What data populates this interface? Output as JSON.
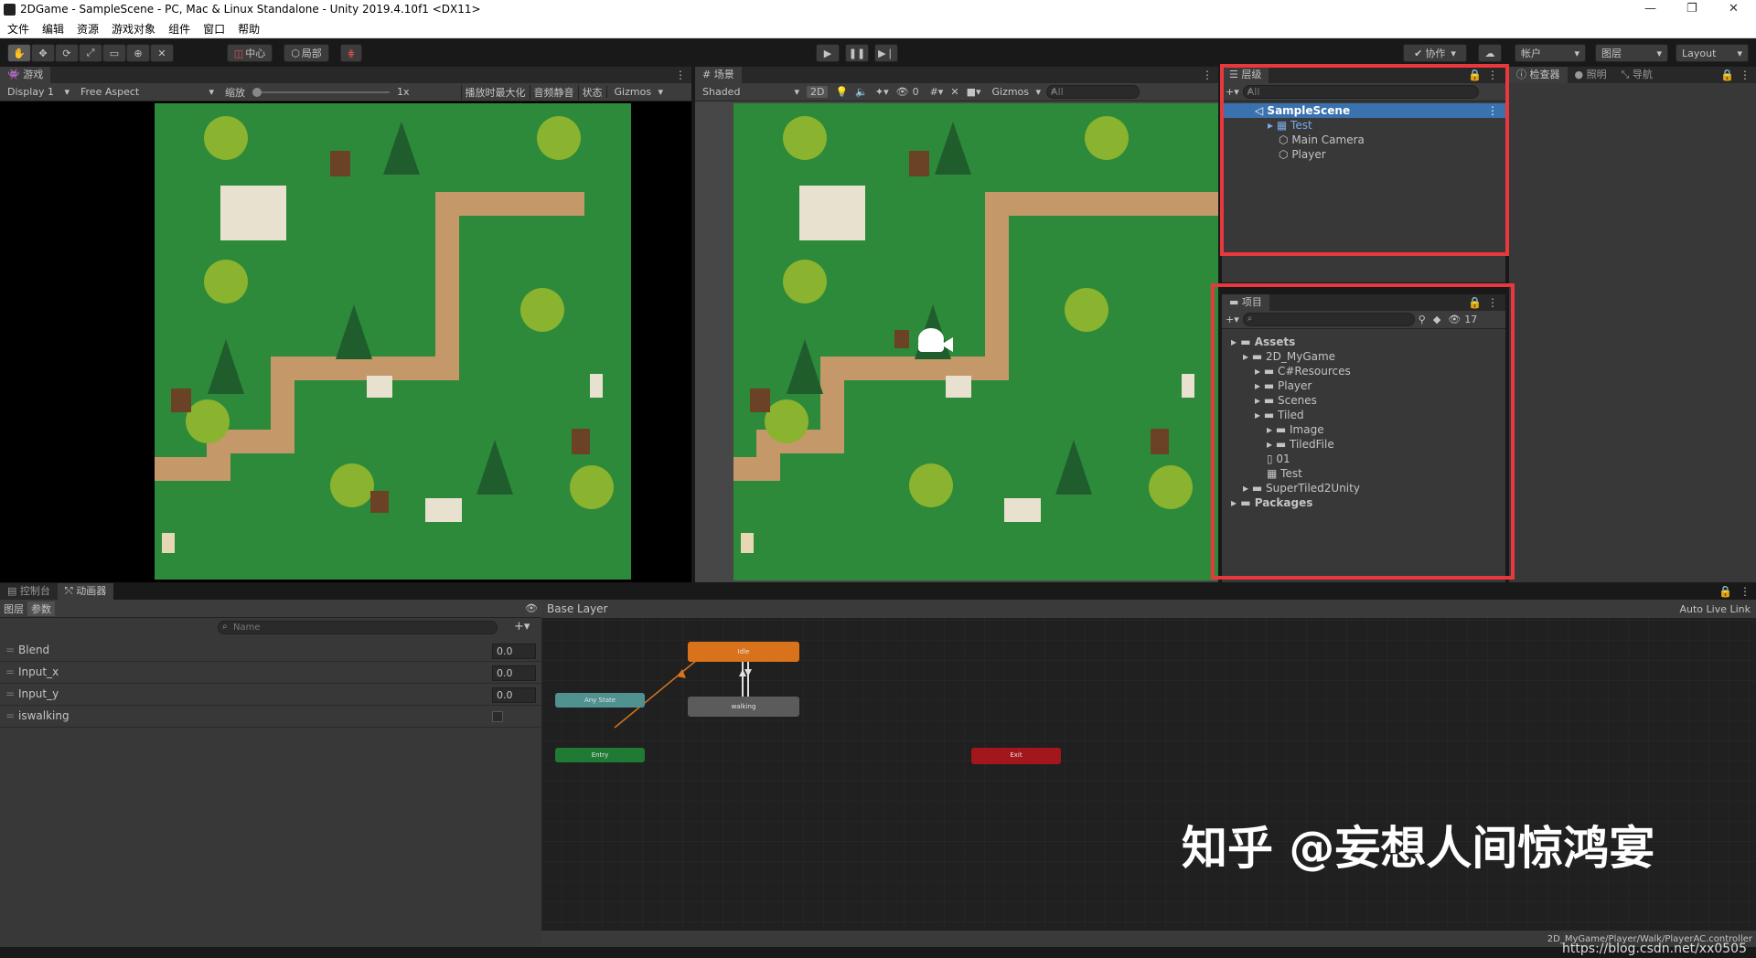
{
  "window": {
    "title": "2DGame - SampleScene - PC, Mac & Linux Standalone - Unity 2019.4.10f1 <DX11>"
  },
  "menu": [
    "文件",
    "编辑",
    "资源",
    "游戏对象",
    "组件",
    "窗口",
    "帮助"
  ],
  "toolbar": {
    "pivot_center": "中心",
    "pivot_local": "局部",
    "collab": "协作",
    "account": "帐户",
    "layers": "图层",
    "layout": "Layout"
  },
  "game": {
    "tab": "游戏",
    "display": "Display 1",
    "aspect": "Free Aspect",
    "scale_label": "缩放",
    "scale_value": "1x",
    "maximize": "播放时最大化",
    "mute": "音频静音",
    "stats": "状态",
    "gizmos": "Gizmos"
  },
  "scene": {
    "tab": "场景",
    "shading": "Shaded",
    "mode2d": "2D",
    "hidden_count": "0",
    "gizmos": "Gizmos",
    "search_placeholder": "All"
  },
  "hierarchy": {
    "tab": "层级",
    "search_placeholder": "All",
    "scene": "SampleScene",
    "items": [
      "Test",
      "Main Camera",
      "Player"
    ]
  },
  "inspector_tabs": [
    "检查器",
    "照明",
    "导航"
  ],
  "project": {
    "tab": "项目",
    "hidden_count": "17",
    "tree": [
      {
        "label": "Assets",
        "depth": 0,
        "bold": true
      },
      {
        "label": "2D_MyGame",
        "depth": 1
      },
      {
        "label": "C#Resources",
        "depth": 2
      },
      {
        "label": "Player",
        "depth": 2
      },
      {
        "label": "Scenes",
        "depth": 2
      },
      {
        "label": "Tiled",
        "depth": 2
      },
      {
        "label": "Image",
        "depth": 3
      },
      {
        "label": "TiledFile",
        "depth": 3
      },
      {
        "label": "01",
        "depth": 3
      },
      {
        "label": "Test",
        "depth": 3
      },
      {
        "label": "SuperTiled2Unity",
        "depth": 1
      },
      {
        "label": "Packages",
        "depth": 0,
        "bold": true
      }
    ]
  },
  "console_tab": "控制台",
  "animator": {
    "tab": "动画器",
    "subtabs": [
      "图层",
      "参数"
    ],
    "search_placeholder": "Name",
    "breadcrumb": "Base Layer",
    "live_link": "Auto Live Link",
    "params": [
      {
        "name": "Blend",
        "value": "0.0"
      },
      {
        "name": "Input_x",
        "value": "0.0"
      },
      {
        "name": "Input_y",
        "value": "0.0"
      },
      {
        "name": "iswalking",
        "value": ""
      }
    ],
    "states": {
      "idle": "Idle",
      "walking": "walking",
      "any": "Any State",
      "entry": "Entry",
      "exit": "Exit"
    },
    "path": "2D_MyGame/Player/Walk/PlayerAC.controller"
  },
  "watermark": "知乎 @妄想人间惊鸿宴",
  "url": "https://blog.csdn.net/xx0505",
  "colors": {
    "accent": "#3a72b0",
    "idle": "#d9731b",
    "entry": "#1f7a34",
    "exit": "#a3161b",
    "any": "#4f9290",
    "highlight_box": "#e8383d",
    "grass": "#2d8a3a",
    "path": "#c49868"
  }
}
